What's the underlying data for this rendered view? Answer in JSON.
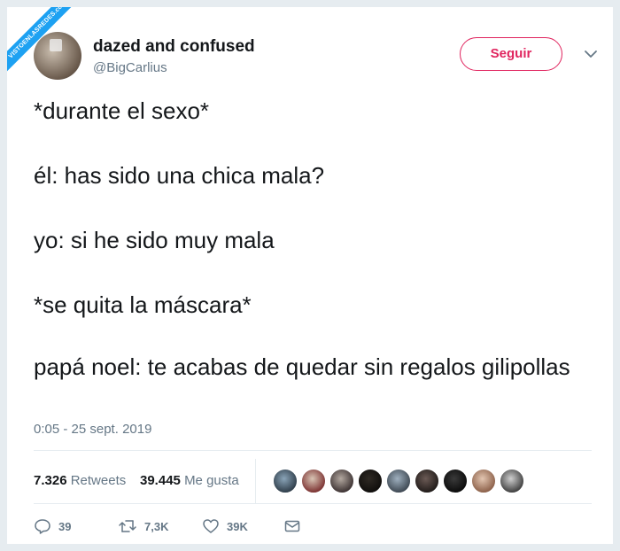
{
  "watermark": {
    "text": "VISTOENLASREDES.com"
  },
  "user": {
    "display_name": "dazed and confused",
    "handle": "@BigCarlius"
  },
  "follow_button": {
    "label": "Seguir"
  },
  "tweet": {
    "lines": [
      "*durante el sexo*",
      "él: has sido una chica mala?",
      "yo: si he sido muy mala",
      "*se quita la máscara*",
      "papá noel: te acabas de quedar sin regalos gilipollas"
    ],
    "timestamp": "0:05 - 25 sept. 2019"
  },
  "stats": {
    "retweets_count": "7.326",
    "retweets_label": "Retweets",
    "likes_count": "39.445",
    "likes_label": "Me gusta"
  },
  "likers_count": 9,
  "actions": {
    "replies": "39",
    "retweets": "7,3K",
    "likes": "39K"
  },
  "colors": {
    "follow_accent": "#e0245e",
    "secondary_text": "#657786",
    "primary_text": "#14171a",
    "watermark": "#1da1f2"
  }
}
